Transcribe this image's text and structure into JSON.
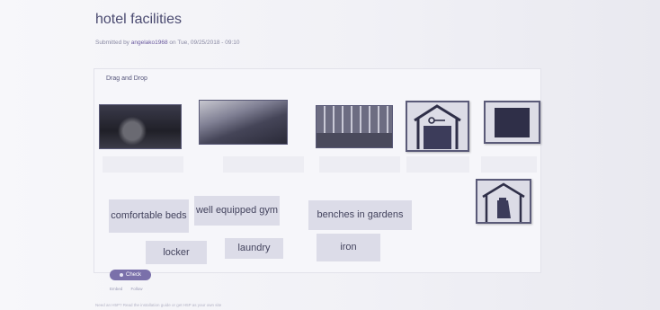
{
  "page": {
    "title": "hotel facilities",
    "submitted_prefix": "Submitted by ",
    "author": "angelako1968",
    "submitted_suffix": " on Tue, 09/25/2018 - 09:10"
  },
  "panel": {
    "header": "Drag and Drop"
  },
  "drop_images": [
    {
      "name": "photo-bedroom"
    },
    {
      "name": "photo-bed-pillows"
    },
    {
      "name": "photo-gym"
    },
    {
      "name": "locker-icon"
    },
    {
      "name": "iron-icon"
    }
  ],
  "word_tiles": [
    {
      "label": "comfortable beds"
    },
    {
      "label": "well equipped gym"
    },
    {
      "label": "benches in gardens"
    },
    {
      "label": "locker"
    },
    {
      "label": "laundry"
    },
    {
      "label": "iron"
    }
  ],
  "extra_image": {
    "name": "laundry-icon"
  },
  "check_button": {
    "label": "Check"
  },
  "bottom_links": [
    "Embed",
    "Follow"
  ],
  "footer": "Need an H5P? Read the installation guide or get H5P as your own site",
  "colors": {
    "accent": "#7a70aa",
    "tile_bg": "#dcdce8",
    "border": "#5a5a78"
  }
}
